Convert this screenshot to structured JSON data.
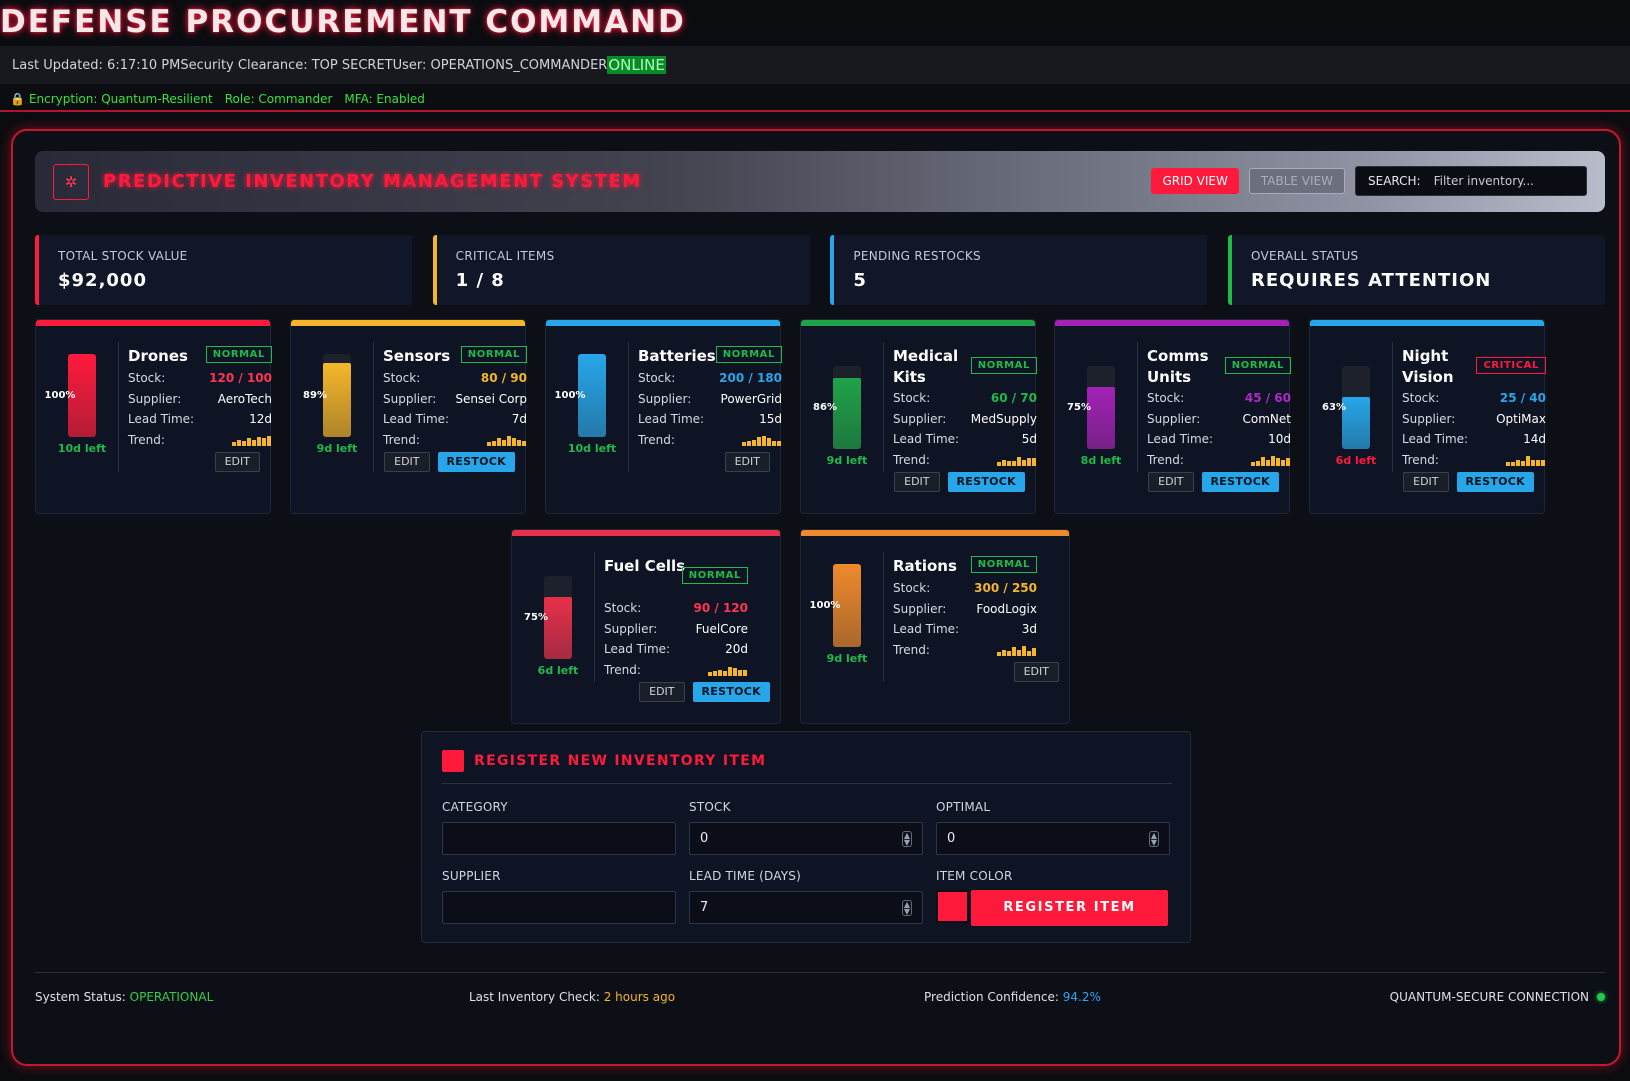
{
  "app": {
    "title": "DEFENSE PROCUREMENT COMMAND",
    "last_updated": "Last Updated: 6:17:10 PM",
    "clearance": "Security Clearance: TOP SECRET",
    "user": "User: OPERATIONS_COMMANDER",
    "online": "ONLINE"
  },
  "security": {
    "encryption": "Encryption: Quantum-Resilient",
    "role": "Role: Commander",
    "mfa": "MFA: Enabled"
  },
  "system": {
    "title": "PREDICTIVE INVENTORY MANAGEMENT SYSTEM",
    "grid_view": "GRID VIEW",
    "table_view": "TABLE VIEW",
    "search_label": "SEARCH:",
    "search_placeholder": "Filter inventory..."
  },
  "stats": [
    {
      "label": "TOTAL STOCK VALUE",
      "value": "$92,000",
      "color": "#ff1a3c"
    },
    {
      "label": "CRITICAL ITEMS",
      "value": "1 / 8",
      "color": "#f5b62a"
    },
    {
      "label": "PENDING RESTOCKS",
      "value": "5",
      "color": "#27a6e9"
    },
    {
      "label": "OVERALL STATUS",
      "value": "REQUIRES ATTENTION",
      "color": "#1fba49"
    }
  ],
  "labels": {
    "stock": "Stock:",
    "supplier": "Supplier:",
    "lead_time": "Lead Time:",
    "trend": "Trend:",
    "edit": "EDIT",
    "restock": "RESTOCK"
  },
  "items": [
    {
      "name": "Drones",
      "status": "NORMAL",
      "stock": "120 / 100",
      "supplier": "AeroTech",
      "lead": "12d",
      "pct": "100%",
      "fill": 1.0,
      "days": "10d left",
      "color": "#ff1a3c",
      "stock_color": "#ff3552",
      "days_color": "#1fba49",
      "restock": false,
      "trend": [
        3,
        5,
        4,
        6,
        5,
        7,
        6,
        8
      ]
    },
    {
      "name": "Sensors",
      "status": "NORMAL",
      "stock": "80 / 90",
      "supplier": "Sensei Corp",
      "lead": "7d",
      "pct": "89%",
      "fill": 0.89,
      "days": "9d left",
      "color": "#f5b62a",
      "stock_color": "#f5b62a",
      "days_color": "#1fba49",
      "restock": true,
      "trend": [
        3,
        4,
        6,
        5,
        8,
        6,
        5,
        4
      ]
    },
    {
      "name": "Batteries",
      "status": "NORMAL",
      "stock": "200 / 180",
      "supplier": "PowerGrid",
      "lead": "15d",
      "pct": "100%",
      "fill": 1.0,
      "days": "10d left",
      "color": "#27a6e9",
      "stock_color": "#27a6e9",
      "days_color": "#1fba49",
      "restock": false,
      "trend": [
        3,
        4,
        5,
        7,
        8,
        6,
        4,
        4
      ]
    },
    {
      "name": "Medical Kits",
      "status": "NORMAL",
      "stock": "60 / 70",
      "supplier": "MedSupply",
      "lead": "5d",
      "pct": "86%",
      "fill": 0.86,
      "days": "9d left",
      "color": "#1fa348",
      "stock_color": "#1fba49",
      "days_color": "#1fba49",
      "restock": true,
      "trend": [
        3,
        5,
        4,
        4,
        7,
        5,
        6,
        6
      ]
    },
    {
      "name": "Comms Units",
      "status": "NORMAL",
      "stock": "45 / 60",
      "supplier": "ComNet",
      "lead": "10d",
      "pct": "75%",
      "fill": 0.75,
      "days": "8d left",
      "color": "#a321b6",
      "stock_color": "#b02ac4",
      "days_color": "#1fba49",
      "restock": true,
      "trend": [
        3,
        4,
        7,
        5,
        8,
        6,
        5,
        6
      ]
    },
    {
      "name": "Night Vision",
      "status": "CRITICAL",
      "stock": "25 / 40",
      "supplier": "OptiMax",
      "lead": "14d",
      "pct": "63%",
      "fill": 0.63,
      "days": "6d left",
      "color": "#27a6e9",
      "stock_color": "#27a6e9",
      "days_color": "#ff1a3c",
      "restock": true,
      "trend": [
        3,
        3,
        5,
        4,
        8,
        5,
        5,
        5
      ]
    },
    {
      "name": "Fuel Cells",
      "status": "NORMAL",
      "stock": "90 / 120",
      "supplier": "FuelCore",
      "lead": "20d",
      "pct": "75%",
      "fill": 0.75,
      "days": "6d left",
      "color": "#e8304b",
      "stock_color": "#ff3552",
      "days_color": "#1fba49",
      "restock": true,
      "trend": [
        3,
        4,
        5,
        4,
        7,
        6,
        5,
        5
      ]
    },
    {
      "name": "Rations",
      "status": "NORMAL",
      "stock": "300 / 250",
      "supplier": "FoodLogix",
      "lead": "3d",
      "pct": "100%",
      "fill": 1.0,
      "days": "9d left",
      "color": "#ef8a2c",
      "stock_color": "#f5b62a",
      "days_color": "#1fba49",
      "restock": false,
      "trend": [
        3,
        5,
        4,
        7,
        5,
        8,
        4,
        6
      ]
    }
  ],
  "form": {
    "title": "REGISTER NEW INVENTORY ITEM",
    "category_label": "CATEGORY",
    "category_value": "",
    "stock_label": "STOCK",
    "stock_value": "0",
    "optimal_label": "OPTIMAL",
    "optimal_value": "0",
    "supplier_label": "SUPPLIER",
    "supplier_value": "",
    "lead_label": "LEAD TIME (DAYS)",
    "lead_value": "7",
    "color_label": "ITEM COLOR",
    "color_value": "#ff1a3c",
    "register": "REGISTER ITEM"
  },
  "footer": {
    "system_status_label": "System Status: ",
    "system_status_value": "OPERATIONAL",
    "inventory_check_label": "Last Inventory Check: ",
    "inventory_check_value": "2 hours ago",
    "confidence_label": "Prediction Confidence: ",
    "confidence_value": "94.2%",
    "connection": "QUANTUM-SECURE CONNECTION"
  }
}
